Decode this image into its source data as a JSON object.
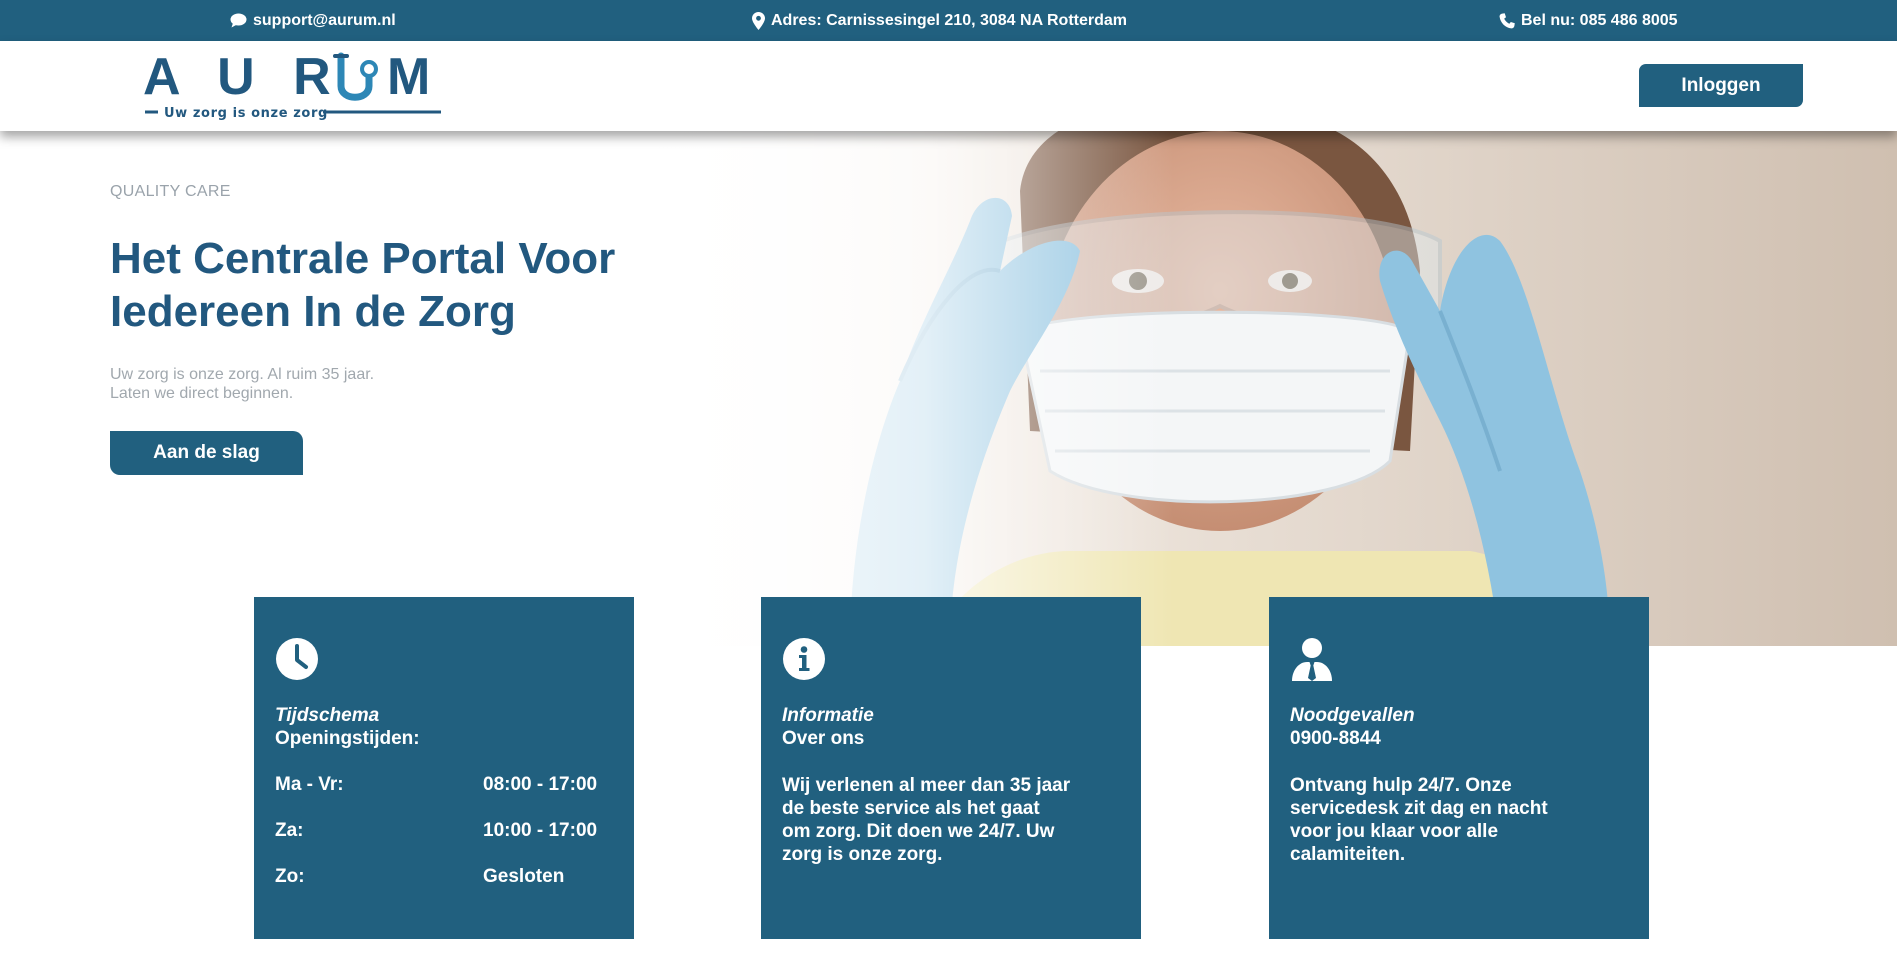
{
  "topbar": {
    "email": "support@aurum.nl",
    "address": "Adres: Carnissesingel 210, 3084 NA Rotterdam",
    "phone": "Bel nu: 085 486 8005",
    "email_icon": "chat-bubble-icon",
    "address_icon": "map-marker-icon",
    "phone_icon": "phone-icon"
  },
  "logo": {
    "letters_left": "A U R",
    "letter_right": "M",
    "tagline": "Uw zorg is onze zorg"
  },
  "header": {
    "login_label": "Inloggen"
  },
  "hero": {
    "kicker": "QUALITY CARE",
    "headline_line1": "Het Centrale Portal Voor",
    "headline_line2": "Iedereen In de Zorg",
    "sub_line1": "Uw zorg is onze zorg. Al ruim 35 jaar.",
    "sub_line2": "Laten we direct beginnen.",
    "cta_label": "Aan de slag"
  },
  "cards": {
    "schedule": {
      "icon": "clock-icon",
      "title": "Tijdschema",
      "subtitle": "Openingstijden:",
      "rows": [
        {
          "day": "Ma - Vr:",
          "time": "08:00 - 17:00"
        },
        {
          "day": "Za:",
          "time": "10:00 - 17:00"
        },
        {
          "day": "Zo:",
          "time": "Gesloten"
        }
      ]
    },
    "info": {
      "icon": "info-icon",
      "title": "Informatie",
      "subtitle": "Over ons",
      "body": "Wij verlenen al meer dan 35 jaar de beste service als het gaat om zorg. Dit doen we 24/7. Uw zorg is onze zorg."
    },
    "emergency": {
      "icon": "user-tie-icon",
      "title": "Noodgevallen",
      "subtitle": "0900-8844",
      "body": "Ontvang hulp 24/7. Onze servicedesk zit dag en nacht voor jou klaar voor alle calamiteiten."
    }
  },
  "colors": {
    "brand": "#21607f",
    "heading": "#22587f",
    "muted_text": "#9aa3ab",
    "glove": "#8fc3e0"
  }
}
